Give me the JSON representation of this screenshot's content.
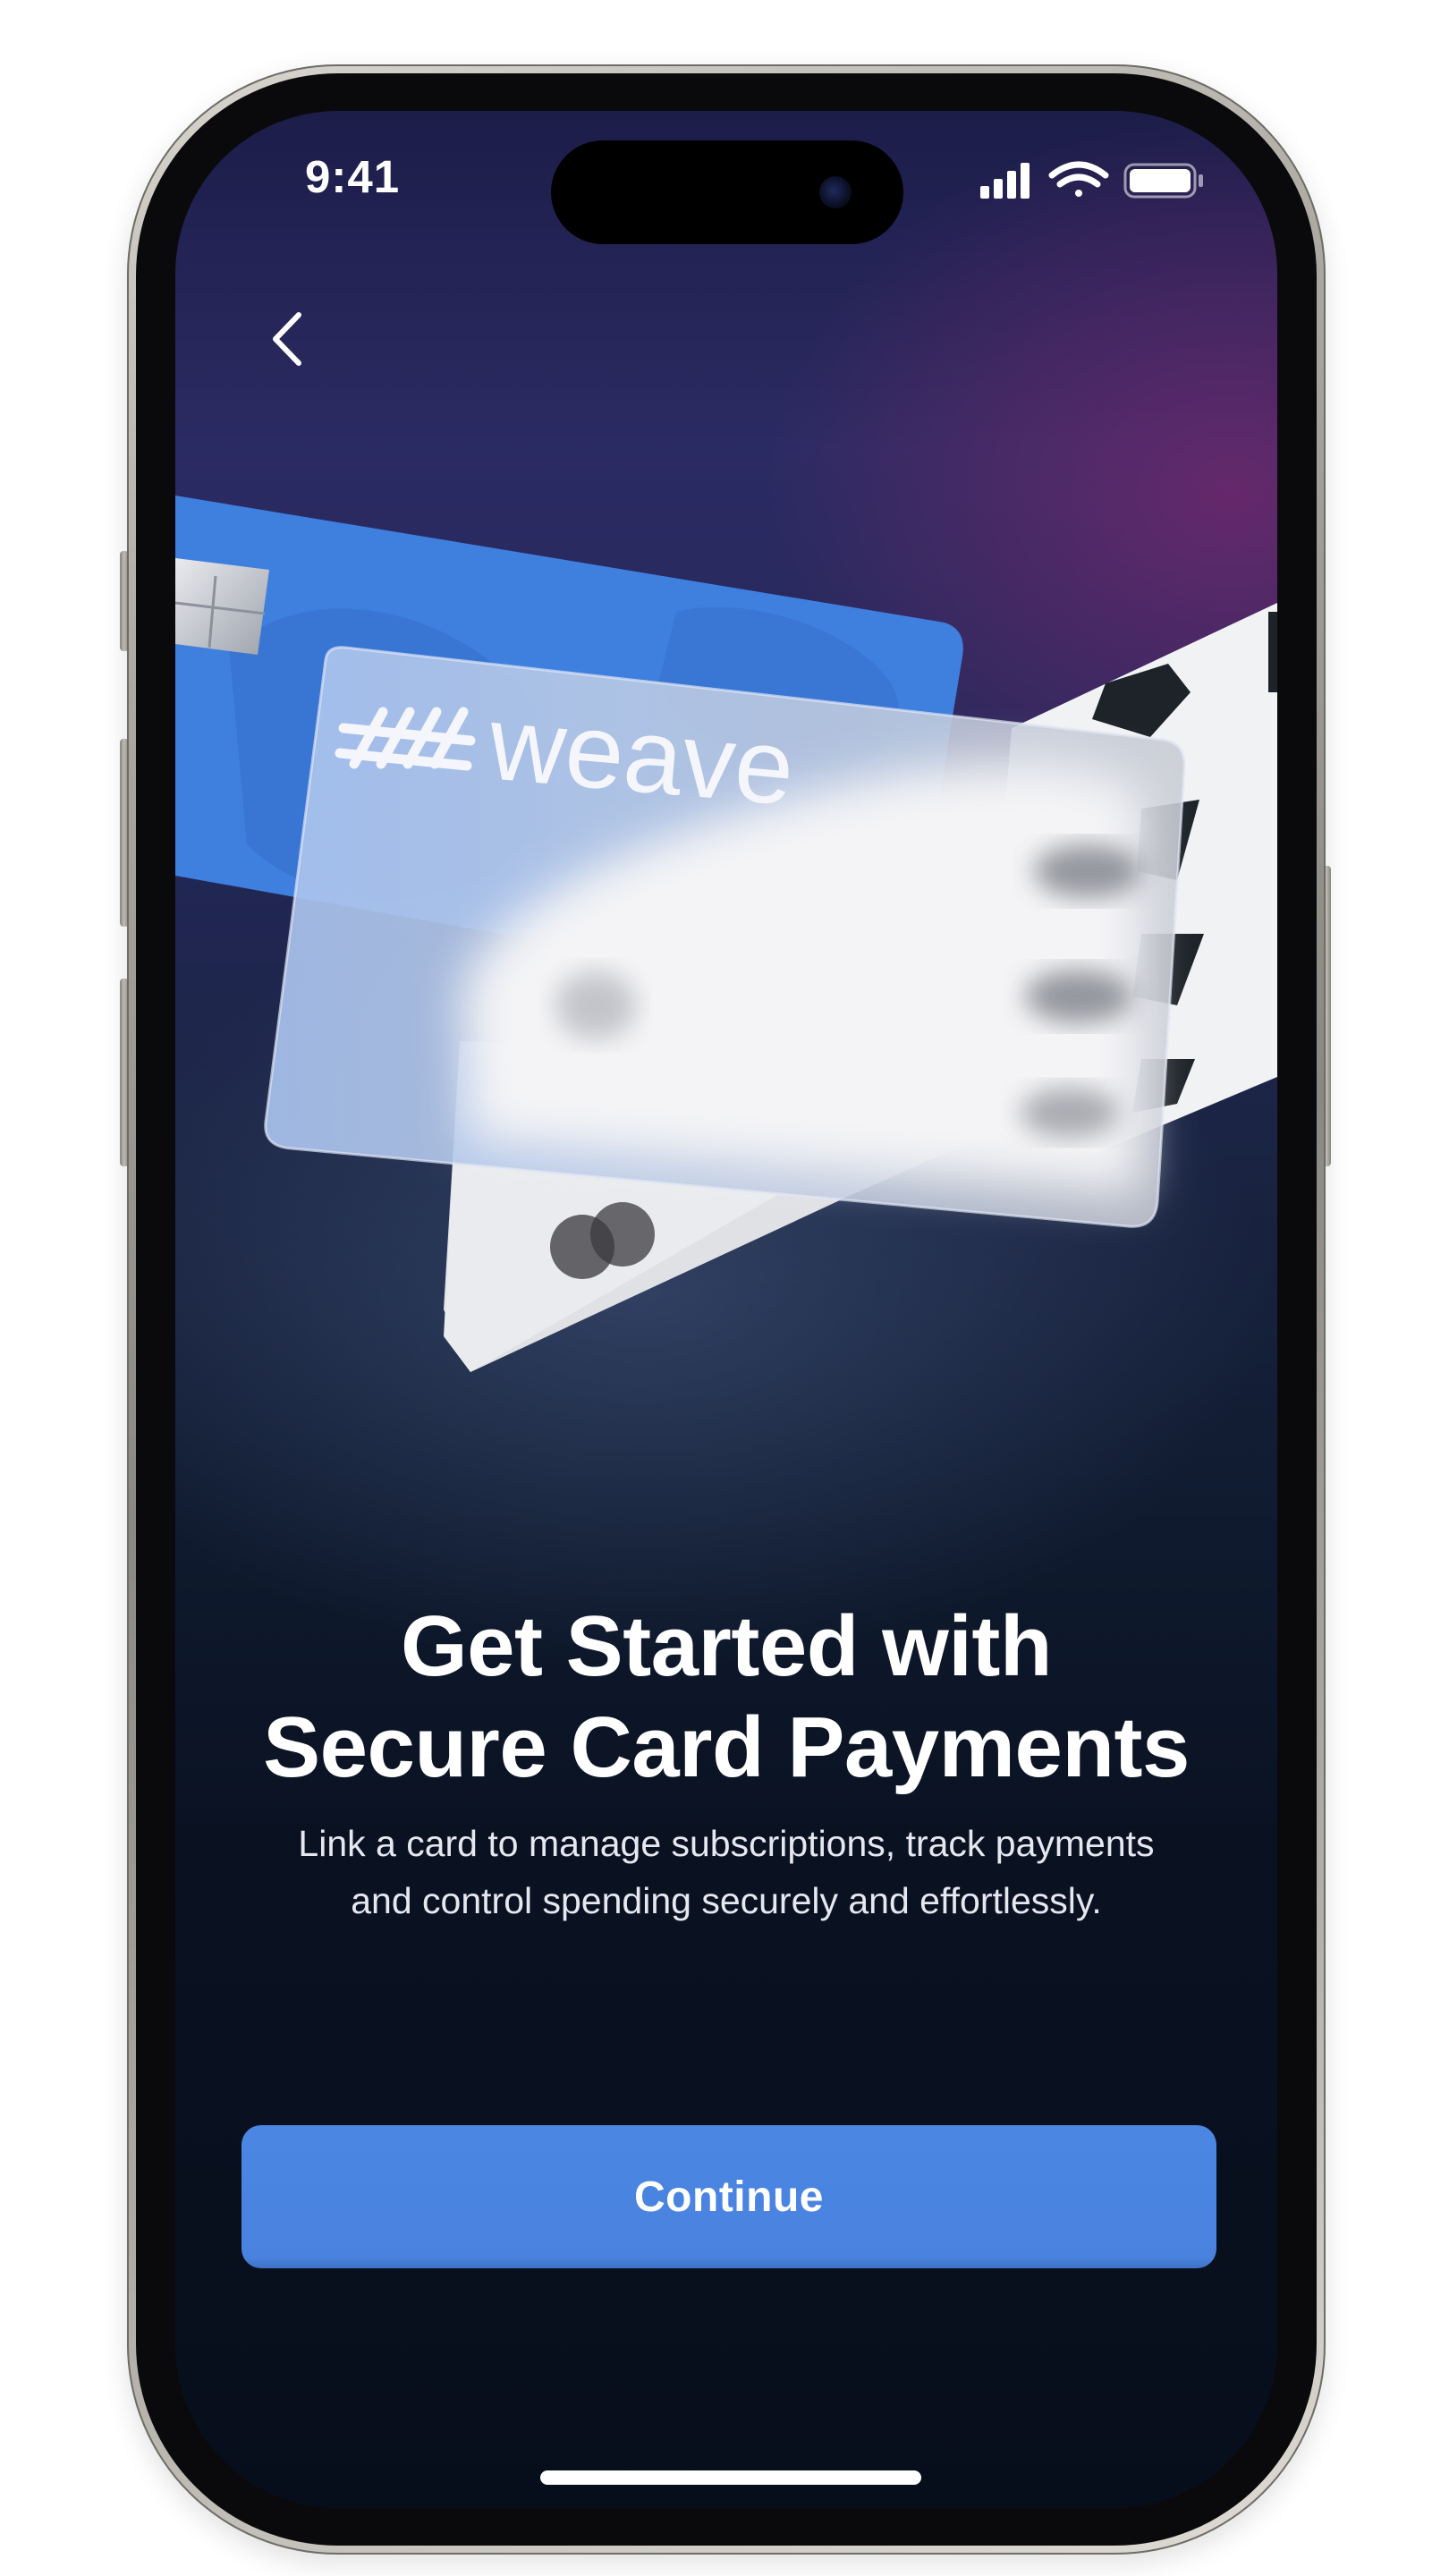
{
  "status_bar": {
    "time": "9:41",
    "signal_icon": "cellular-signal-icon",
    "wifi_icon": "wifi-icon",
    "battery_icon": "battery-icon"
  },
  "navigation": {
    "back_icon": "chevron-left-icon"
  },
  "card_art": {
    "brand_logo_text": "weave",
    "cards": [
      "blue-credit-card",
      "frosted-weave-card",
      "white-card",
      "striped-card"
    ]
  },
  "hero": {
    "title_line1": "Get Started with",
    "title_line2": "Secure Card Payments",
    "subtitle_line1": "Link a card to manage subscriptions, track payments",
    "subtitle_line2": "and control spending securely and effortlessly."
  },
  "actions": {
    "continue_label": "Continue"
  },
  "colors": {
    "accent": "#4A83DF",
    "background_top": "#1D1D4A",
    "background_bottom": "#070E1B",
    "text_primary": "#FFFFFF"
  }
}
